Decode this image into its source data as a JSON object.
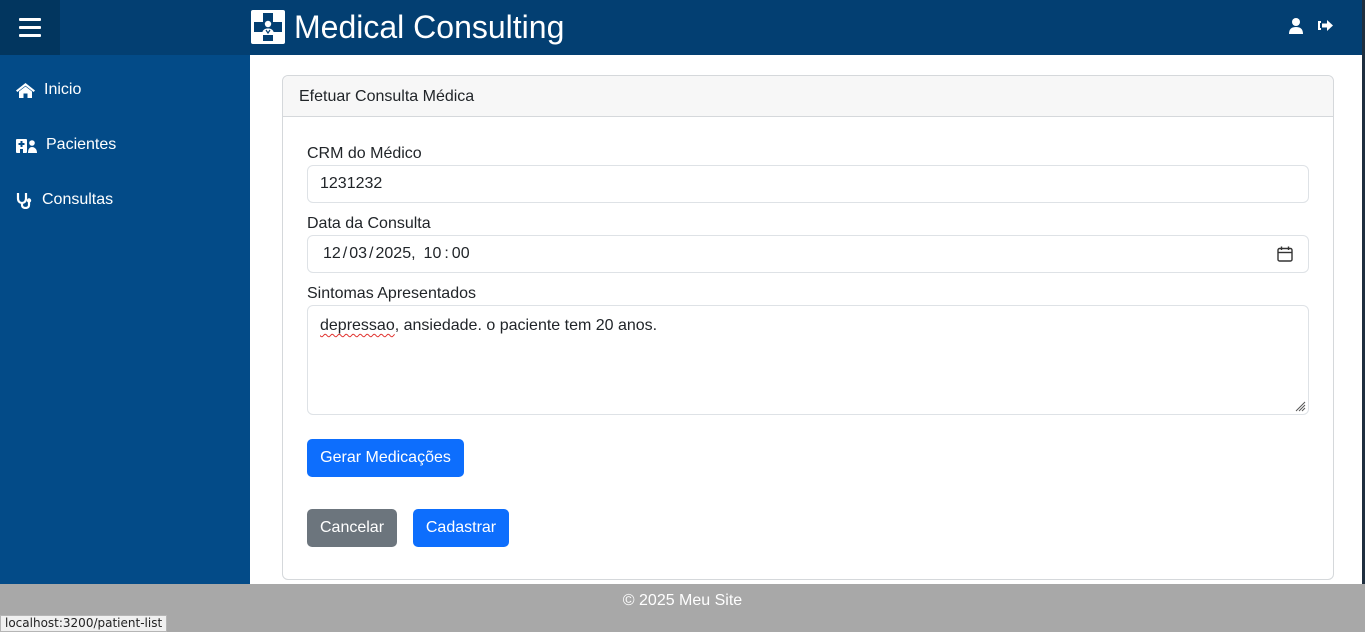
{
  "header": {
    "title": "Medical Consulting",
    "menu_icon": "hamburger-icon",
    "logo_icon": "medical-cross-doctor-icon",
    "user_icon": "user-icon",
    "logout_icon": "sign-out-icon",
    "bg_color": "#033f72"
  },
  "sidebar": {
    "bg_color": "#034b88",
    "items": [
      {
        "label": "Inicio",
        "icon": "home-icon"
      },
      {
        "label": "Pacientes",
        "icon": "hospital-user-icon"
      },
      {
        "label": "Consultas",
        "icon": "stethoscope-icon"
      }
    ]
  },
  "form": {
    "title": "Efetuar Consulta Médica",
    "crm_label": "CRM do Médico",
    "crm_value": "1231232",
    "date_label": "Data da Consulta",
    "date_day": "12",
    "date_month": "03",
    "date_year": "2025",
    "time_hour": "10",
    "time_minute": "00",
    "calendar_icon": "calendar-icon",
    "symptoms_label": "Sintomas Apresentados",
    "symptoms_misspelled": "depressao",
    "symptoms_rest": ", ansiedade. o paciente tem 20 anos.",
    "generate_button": "Gerar Medicações",
    "cancel_button": "Cancelar",
    "submit_button": "Cadastrar",
    "primary_color": "#0d6efd",
    "secondary_color": "#6c757d"
  },
  "footer": {
    "text": "© 2025 Meu Site"
  },
  "statusbar": {
    "url": "localhost:3200/patient-list"
  }
}
